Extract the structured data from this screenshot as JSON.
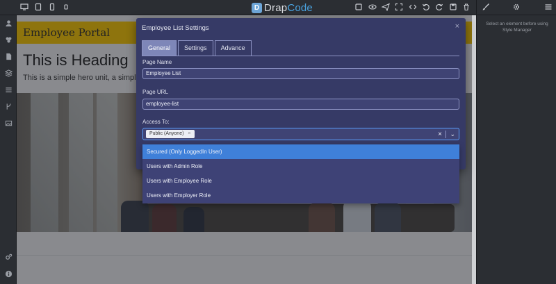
{
  "app": {
    "brand_prefix": "Drap",
    "brand_suffix": "Code",
    "logo_glyph": "D"
  },
  "topbar": {
    "device_icons": [
      "desktop-icon",
      "tablet-icon",
      "mobile-icon",
      "mobile-landscape-icon"
    ],
    "tool_icons": [
      "square-icon",
      "eye-icon",
      "send-icon",
      "fullscreen-icon",
      "code-icon",
      "undo-icon",
      "redo-icon",
      "save-icon",
      "trash-icon"
    ]
  },
  "right_panel": {
    "message": "Select an element before using Style Manager"
  },
  "canvas": {
    "site_brand": "Employee Portal",
    "heading": "This is Heading",
    "hero_text": "This is a simple hero unit, a simple"
  },
  "modal": {
    "title": "Employee List Settings",
    "close_glyph": "×",
    "tabs": [
      {
        "label": "General",
        "active": true
      },
      {
        "label": "Settings",
        "active": false
      },
      {
        "label": "Advance",
        "active": false
      }
    ],
    "page_name_label": "Page Name",
    "page_name_value": "Employee List",
    "page_url_label": "Page URL",
    "page_url_value": "employee-list",
    "access_label": "Access To:",
    "access_selected": "Public (Anyone)",
    "chip_remove": "×",
    "clear_glyph": "×",
    "arrow_glyph": "⌄",
    "options": [
      "Secured (Only LoggedIn User)",
      "Users with Admin Role",
      "Users with Employee Role",
      "Users with Employer Role"
    ]
  },
  "colors": {
    "accent": "#3f80d9",
    "modal_bg": "#363a66",
    "header_yellow": "#f2c200"
  }
}
